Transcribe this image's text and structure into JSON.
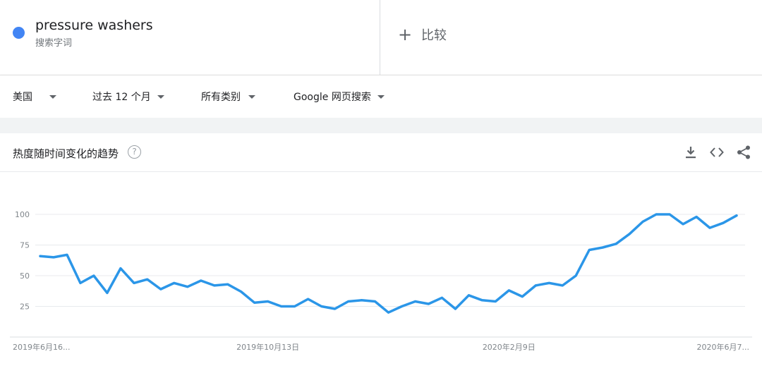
{
  "header": {
    "term": "pressure washers",
    "term_sub": "搜索字词",
    "term_color": "#4285f4",
    "compare_label": "比较"
  },
  "filters": {
    "region": "美国",
    "time": "过去 12 个月",
    "category": "所有类别",
    "search_type": "Google 网页搜索"
  },
  "panel": {
    "title": "热度随时间变化的趋势",
    "help_glyph": "?"
  },
  "icons": {
    "download": "download-icon",
    "embed": "embed-code-icon",
    "share": "share-icon",
    "help": "help-icon"
  },
  "chart_data": {
    "type": "line",
    "title": "",
    "xlabel": "",
    "ylabel": "",
    "ylim": [
      0,
      100
    ],
    "yticks": [
      25,
      50,
      75,
      100
    ],
    "grid": true,
    "line_color": "#2b96e8",
    "x_tick_labels": [
      "2019年6月16...",
      "2019年10月13日",
      "2020年2月9日",
      "2020年6月7..."
    ],
    "x_tick_index": [
      0,
      17,
      35,
      53
    ],
    "series": [
      {
        "values": [
          66,
          65,
          67,
          44,
          50,
          36,
          56,
          44,
          47,
          39,
          44,
          41,
          46,
          42,
          43,
          37,
          28,
          29,
          25,
          25,
          31,
          25,
          23,
          29,
          30,
          29,
          20,
          25,
          29,
          27,
          32,
          23,
          34,
          30,
          29,
          38,
          33,
          42,
          44,
          42,
          50,
          71,
          73,
          76,
          84,
          94,
          100,
          100,
          92,
          98,
          89,
          93,
          99
        ]
      }
    ]
  }
}
